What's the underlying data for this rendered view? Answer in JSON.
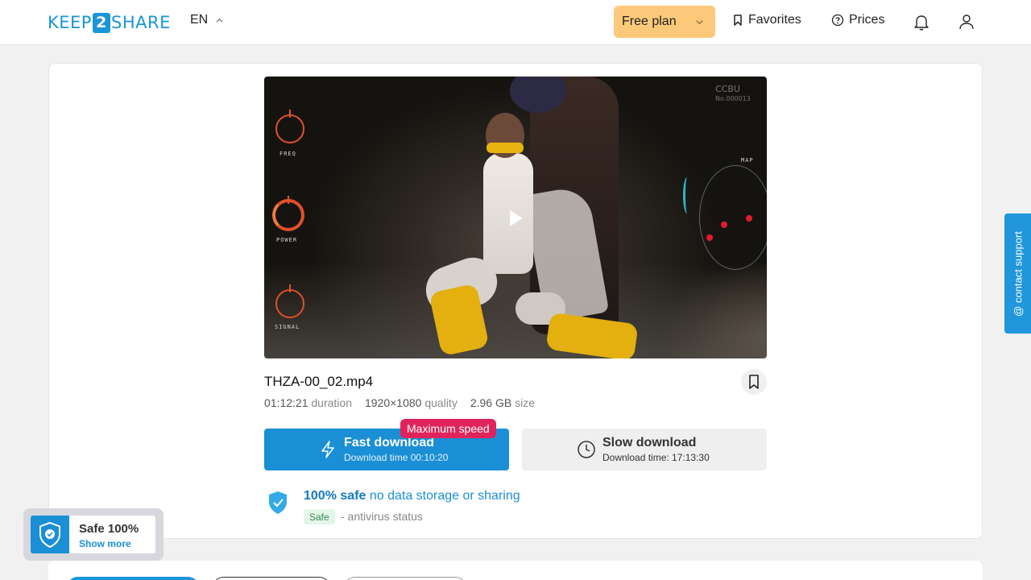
{
  "header": {
    "logo": {
      "left": "KEEP",
      "middle": "2",
      "right": "SHARE"
    },
    "language": "EN",
    "plan_label": "Free plan",
    "favorites_label": "Favorites",
    "prices_label": "Prices",
    "icons": [
      "chevron-up-icon",
      "chevron-down-icon",
      "bookmark-icon",
      "question-circle-icon",
      "bell-icon",
      "user-icon"
    ]
  },
  "video": {
    "hud_labels": [
      "FREQ",
      "POWER",
      "SIGNAL",
      "MAP"
    ],
    "watermark": {
      "line1": "CCBU",
      "line2": "No.000013"
    }
  },
  "file": {
    "name": "THZA-00_02.mp4",
    "duration": "01:12:21",
    "duration_label": "duration",
    "quality": "1920×1080",
    "quality_label": "quality",
    "size": "2.96 GB",
    "size_label": "size"
  },
  "downloads": {
    "badge": "Maximum speed",
    "fast": {
      "title": "Fast download",
      "subtitle": "Download time 00:10:20"
    },
    "slow": {
      "title": "Slow download",
      "subtitle": "Download time: 17:13:30"
    }
  },
  "safety": {
    "strong": "100% safe",
    "rest": " no data storage or sharing",
    "badge": "Safe",
    "status": "- antivirus status"
  },
  "contact_support": "@ contact support",
  "safe_widget": {
    "title": "Safe 100%",
    "link": "Show more"
  },
  "colors": {
    "accent": "#1a8fd6",
    "plan": "#fcc97a",
    "badge": "#e0245b",
    "safe_bg": "#e4f6ea"
  }
}
